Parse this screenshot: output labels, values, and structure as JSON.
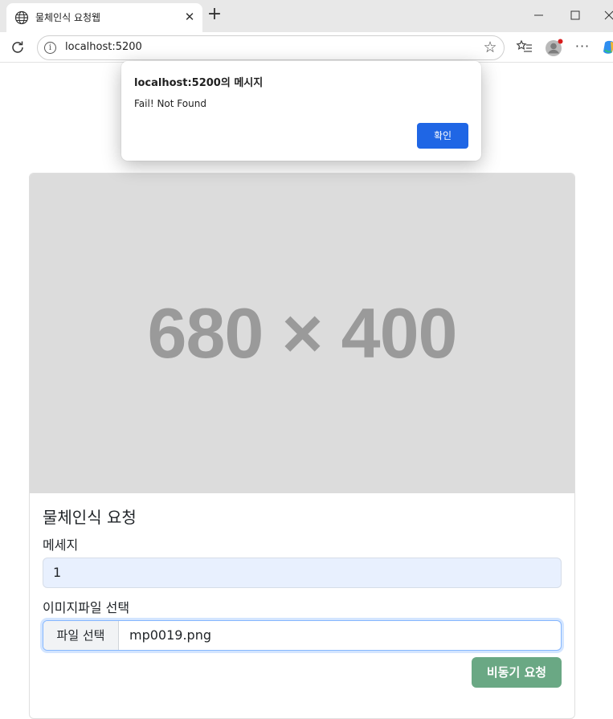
{
  "browser": {
    "tab_title": "물체인식 요청웹",
    "tab_close_glyph": "✕",
    "new_tab_glyph": "+",
    "url": "localhost:5200",
    "more_glyph": "···",
    "icons": [
      "globe-icon",
      "close-icon",
      "plus-icon",
      "minimize-icon",
      "maximize-icon",
      "window-close-icon",
      "reload-icon",
      "info-icon",
      "star-icon",
      "favorites-icon",
      "profile-icon",
      "more-icon",
      "copilot-icon"
    ]
  },
  "dialog": {
    "title": "localhost:5200의 메시지",
    "message": "Fail! Not Found",
    "ok_label": "확인",
    "accent": "#1f66e5"
  },
  "card": {
    "placeholder_text": "680 × 400",
    "title": "물체인식 요청",
    "message_label": "메세지",
    "message_value": "1",
    "file_label": "이미지파일 선택",
    "file_button": "파일 선택",
    "file_name": "mp0019.png",
    "submit_label": "비동기 요청",
    "submit_color": "#6aa884"
  }
}
